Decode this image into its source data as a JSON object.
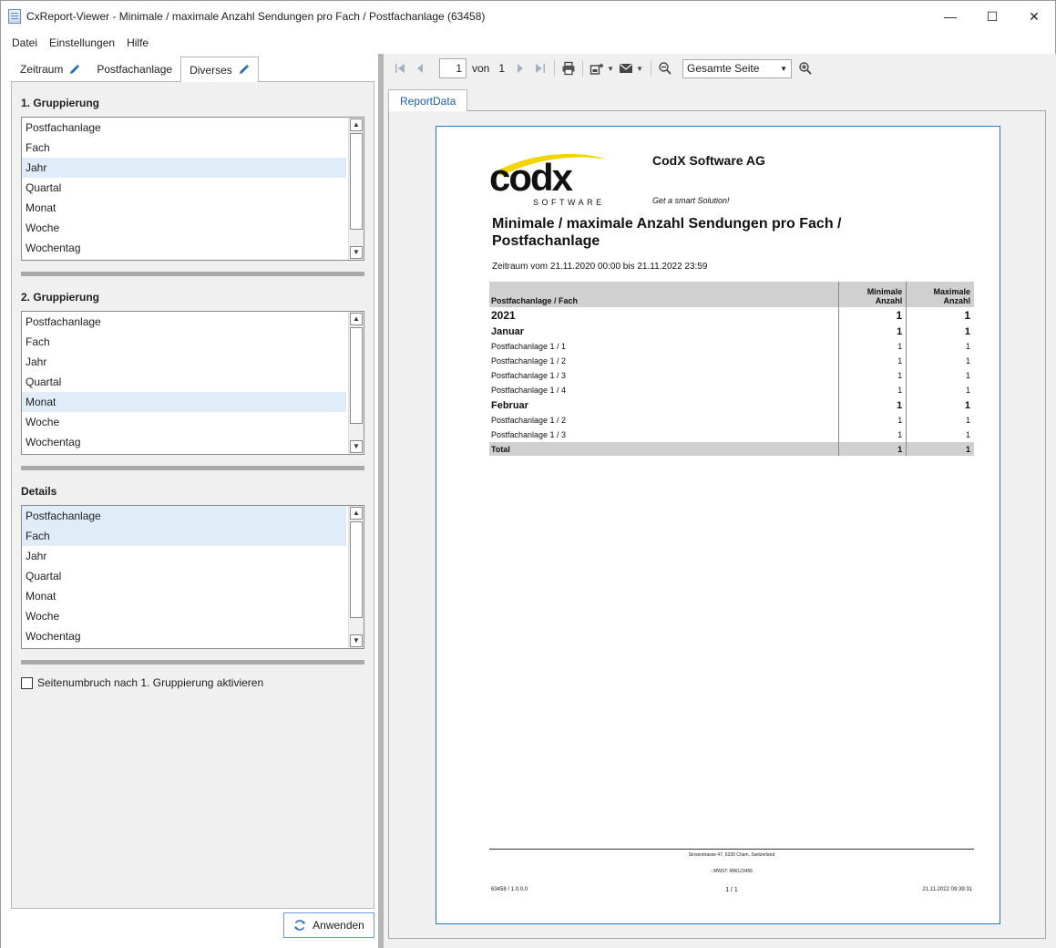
{
  "window": {
    "title": "CxReport-Viewer - Minimale / maximale Anzahl Sendungen pro Fach / Postfachanlage (63458)",
    "controls": {
      "minimize": "—",
      "maximize": "☐",
      "close": "✕"
    }
  },
  "menu": [
    "Datei",
    "Einstellungen",
    "Hilfe"
  ],
  "tabs": [
    {
      "label": "Zeitraum",
      "icon": "pencil-icon"
    },
    {
      "label": "Postfachanlage",
      "icon": ""
    },
    {
      "label": "Diverses",
      "icon": "pencil-icon",
      "active": true
    }
  ],
  "groups": [
    {
      "label": "1. Gruppierung",
      "items": [
        "Postfachanlage",
        "Fach",
        "Jahr",
        "Quartal",
        "Monat",
        "Woche",
        "Wochentag"
      ],
      "selected": [
        2
      ]
    },
    {
      "label": "2. Gruppierung",
      "items": [
        "Postfachanlage",
        "Fach",
        "Jahr",
        "Quartal",
        "Monat",
        "Woche",
        "Wochentag"
      ],
      "selected": [
        4
      ]
    },
    {
      "label": "Details",
      "items": [
        "Postfachanlage",
        "Fach",
        "Jahr",
        "Quartal",
        "Monat",
        "Woche",
        "Wochentag"
      ],
      "selected": [
        0,
        1
      ]
    }
  ],
  "checkbox": {
    "label": "Seitenumbruch nach 1. Gruppierung aktivieren",
    "checked": false
  },
  "apply_button": "Anwenden",
  "toolbar": {
    "page_current": "1",
    "page_of_label": "von",
    "page_total": "1",
    "zoom_value": "Gesamte Seite"
  },
  "report_tab": "ReportData",
  "report": {
    "company": "CodX Software AG",
    "slogan": "Get a smart Solution!",
    "logo_text": "codx",
    "logo_sub": "SOFTWARE",
    "title": "Minimale / maximale Anzahl Sendungen pro Fach / Postfachanlage",
    "period": "Zeitraum vom 21.11.2020 00:00 bis 21.11.2022 23:59",
    "columns": [
      "Postfachanlage / Fach",
      "Minimale Anzahl",
      "Maximale Anzahl"
    ],
    "rows": [
      {
        "level": "lvl1",
        "label": "2021",
        "min": "1",
        "max": "1"
      },
      {
        "level": "lvl2",
        "label": "Januar",
        "min": "1",
        "max": "1"
      },
      {
        "level": "lvl3",
        "label": "Postfachanlage 1 / 1",
        "min": "1",
        "max": "1"
      },
      {
        "level": "lvl3",
        "label": "Postfachanlage 1 / 2",
        "min": "1",
        "max": "1"
      },
      {
        "level": "lvl3",
        "label": "Postfachanlage 1 / 3",
        "min": "1",
        "max": "1"
      },
      {
        "level": "lvl3",
        "label": "Postfachanlage 1 / 4",
        "min": "1",
        "max": "1"
      },
      {
        "level": "lvl2",
        "label": "Februar",
        "min": "1",
        "max": "1"
      },
      {
        "level": "lvl3",
        "label": "Postfachanlage 1 / 2",
        "min": "1",
        "max": "1"
      },
      {
        "level": "lvl3",
        "label": "Postfachanlage 1 / 3",
        "min": "1",
        "max": "1"
      },
      {
        "level": "total",
        "label": "Total",
        "min": "1",
        "max": "1"
      }
    ],
    "footer": {
      "address": "Sinserstrasse 47, 6330 Cham, Switzerland",
      "vat": "- MWST: MW123456",
      "left": "63458 / 1.0.0.0",
      "page": "1 / 1",
      "right": "21.11.2022 09:39:31"
    }
  },
  "colors": {
    "accent": "#1f7fc8",
    "selection": "#e0ecf8",
    "logo_yellow": "#f2d400"
  }
}
